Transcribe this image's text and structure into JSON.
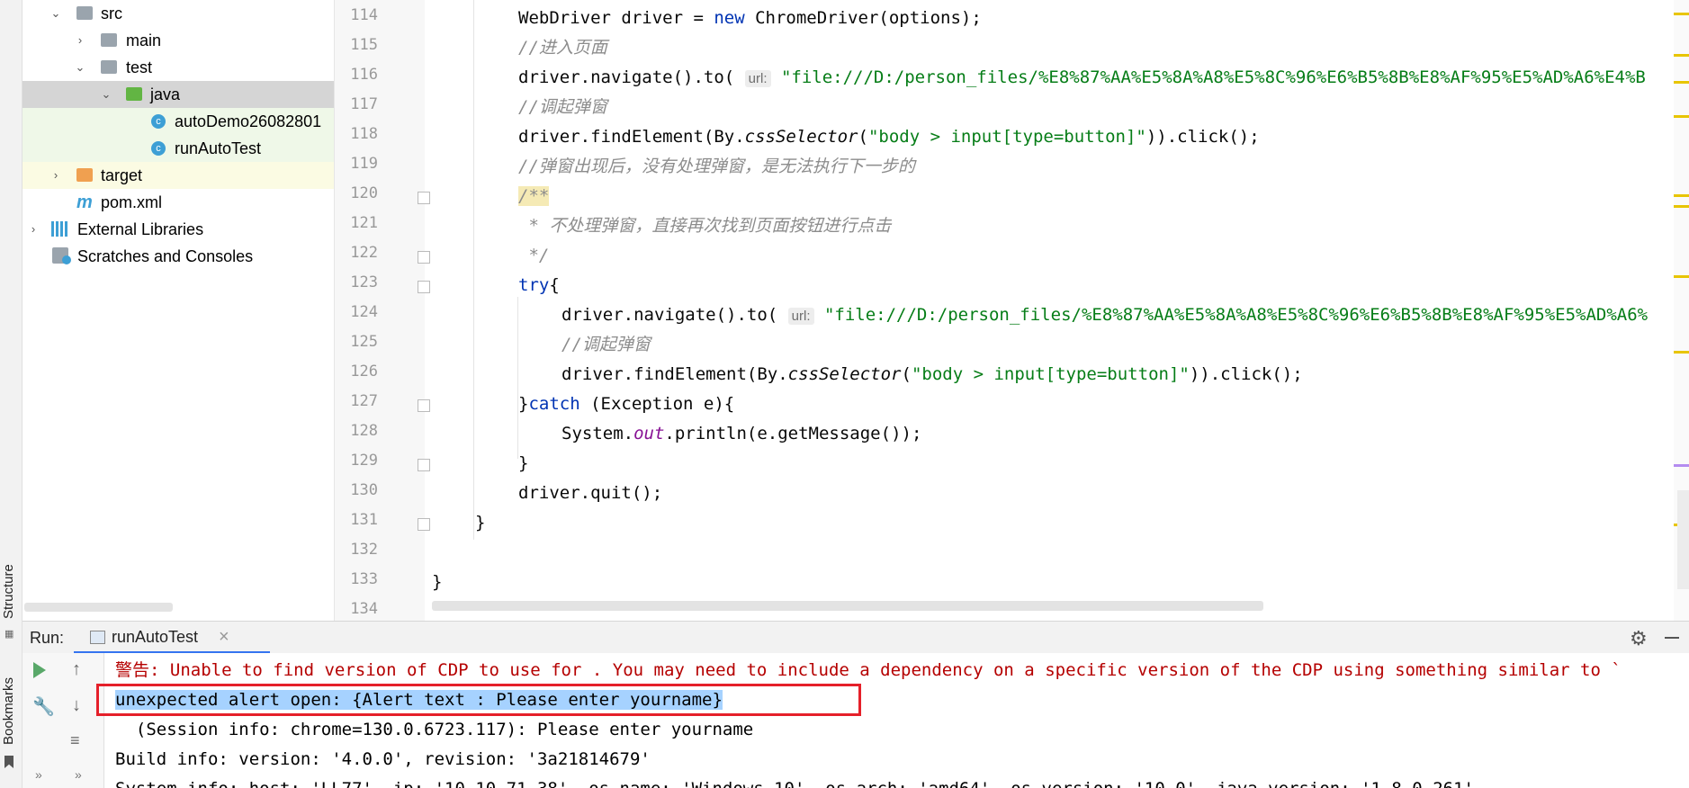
{
  "left_strip": {
    "structure_label": "Structure",
    "bookmarks_label": "Bookmarks"
  },
  "tree": {
    "items": [
      {
        "label": "src",
        "arrow": "⌄",
        "icon": "folder-grey"
      },
      {
        "label": "main",
        "arrow": "›",
        "icon": "folder-grey"
      },
      {
        "label": "test",
        "arrow": "⌄",
        "icon": "folder-grey"
      },
      {
        "label": "java",
        "arrow": "⌄",
        "icon": "folder-green"
      },
      {
        "label": "autoDemo26082801",
        "icon": "class"
      },
      {
        "label": "runAutoTest",
        "icon": "class"
      },
      {
        "label": "target",
        "arrow": "›",
        "icon": "folder-orange"
      },
      {
        "label": "pom.xml",
        "icon": "maven"
      },
      {
        "label": "External Libraries",
        "arrow": "›",
        "icon": "libraries"
      },
      {
        "label": "Scratches and Consoles",
        "icon": "scratches"
      }
    ]
  },
  "editor": {
    "line_numbers": [
      "114",
      "115",
      "116",
      "117",
      "118",
      "119",
      "120",
      "121",
      "122",
      "123",
      "124",
      "125",
      "126",
      "127",
      "128",
      "129",
      "130",
      "131",
      "132",
      "133",
      "134"
    ],
    "hint_url": "url:",
    "lines": {
      "l114_a": "WebDriver driver = ",
      "l114_kw": "new",
      "l114_b": " ChromeDriver(options);",
      "l115": "//进入页面",
      "l116_a": "driver.navigate().to( ",
      "l116_str": "\"file:///D:/person_files/%E8%87%AA%E5%8A%A8%E5%8C%96%E6%B5%8B%E8%AF%95%E5%AD%A6%E4%B",
      "l117": "//调起弹窗",
      "l118_a": "driver.findElement(By.",
      "l118_it": "cssSelector",
      "l118_b": "(",
      "l118_str": "\"body > input[type=button]\"",
      "l118_c": ")).click();",
      "l119": "//弹窗出现后，没有处理弹窗，是无法执行下一步的",
      "l120": "/**",
      "l121": " * 不处理弹窗，直接再次找到页面按钮进行点击",
      "l122": " */",
      "l123_kw": "try",
      "l123_b": "{",
      "l124_a": "driver.navigate().to( ",
      "l124_str": "\"file:///D:/person_files/%E8%87%AA%E5%8A%A8%E5%8C%96%E6%B5%8B%E8%AF%95%E5%AD%A6%",
      "l125": "//调起弹窗",
      "l126_a": "driver.findElement(By.",
      "l126_it": "cssSelector",
      "l126_b": "(",
      "l126_str": "\"body > input[type=button]\"",
      "l126_c": ")).click();",
      "l127_a": "}",
      "l127_kw": "catch",
      "l127_b": " (Exception e){",
      "l128_a": "System.",
      "l128_out": "out",
      "l128_b": ".println(e.getMessage());",
      "l129": "}",
      "l130": "driver.quit();",
      "l131": "}",
      "l133": "}"
    }
  },
  "run": {
    "label": "Run:",
    "tab_label": "runAutoTest",
    "close": "×"
  },
  "console": {
    "line1": "警告: Unable to find version of CDP to use for . You may need to include a dependency on a specific version of the CDP using something similar to `",
    "line2": "unexpected alert open: {Alert text : Please enter yourname}",
    "line3": "  (Session info: chrome=130.0.6723.117): Please enter yourname",
    "line4": "Build info: version: '4.0.0', revision: '3a21814679'",
    "line5": "System info: host: 'LL77', ip: '10.10.71.38', os.name: 'Windows 10', os.arch: 'amd64', os.version: '10.0', java.version: '1.8.0_261'"
  },
  "colors": {
    "keyword": "#0033b3",
    "string": "#067d17",
    "comment": "#8c8c8c",
    "error": "#b50000",
    "selection": "#a6d2ff",
    "highlight_box": "#e5202a"
  }
}
